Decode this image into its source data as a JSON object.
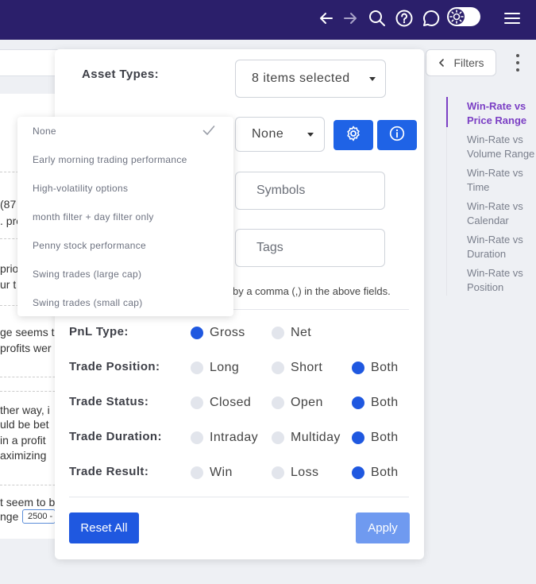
{
  "topbar": {
    "icons": [
      "arrow-left-icon",
      "arrow-right-icon",
      "search-icon",
      "help-icon",
      "chat-icon",
      "sun-icon",
      "menu-icon"
    ]
  },
  "background": {
    "filters_label": "Filters",
    "fragments": [
      "(87",
      ". pro",
      "prio",
      "ur t",
      "ge seems t",
      "profits wer",
      "ther way, i",
      "uld be bet",
      "in a profit",
      "aximizing",
      "t seem to b",
      "nge"
    ],
    "range_chip": "2500 -",
    "toc": [
      "Win-Rate vs Price Range",
      "Win-Rate vs Volume Range",
      "Win-Rate vs Time",
      "Win-Rate vs Calendar",
      "Win-Rate vs Duration",
      "Win-Rate vs Position"
    ]
  },
  "panel": {
    "asset_types_label": "Asset Types:",
    "asset_types_value": "8 items selected",
    "preset_value": "None",
    "symbols_placeholder": "Symbols",
    "tags_placeholder": "Tags",
    "hint": "by a comma (,) in the above fields.",
    "rows": [
      {
        "label": "PnL Type:",
        "options": [
          {
            "text": "Gross",
            "on": true
          },
          {
            "text": "Net",
            "on": false
          }
        ]
      },
      {
        "label": "Trade Position:",
        "options": [
          {
            "text": "Long",
            "on": false
          },
          {
            "text": "Short",
            "on": false
          },
          {
            "text": "Both",
            "on": true
          }
        ]
      },
      {
        "label": "Trade Status:",
        "options": [
          {
            "text": "Closed",
            "on": false
          },
          {
            "text": "Open",
            "on": false
          },
          {
            "text": "Both",
            "on": true
          }
        ]
      },
      {
        "label": "Trade Duration:",
        "options": [
          {
            "text": "Intraday",
            "on": false
          },
          {
            "text": "Multiday",
            "on": false
          },
          {
            "text": "Both",
            "on": true
          }
        ]
      },
      {
        "label": "Trade Result:",
        "options": [
          {
            "text": "Win",
            "on": false
          },
          {
            "text": "Loss",
            "on": false
          },
          {
            "text": "Both",
            "on": true
          }
        ]
      }
    ],
    "reset_label": "Reset All",
    "apply_label": "Apply"
  },
  "dropdown": {
    "items": [
      "None",
      "Early morning trading performance",
      "High-volatility options",
      "month filter + day filter only",
      "Penny stock performance",
      "Swing trades (large cap)",
      "Swing trades (small cap)"
    ],
    "selected": "None"
  },
  "colors": {
    "nav": "#2b1f6b",
    "primary": "#1f58e0",
    "apply_disabled": "#6f9af0",
    "toc_active": "#7b3fc4"
  }
}
